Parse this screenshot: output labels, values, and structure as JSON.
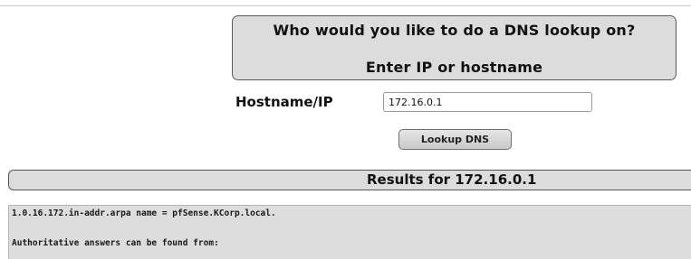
{
  "lookup_form": {
    "prompt_title": "Who would you like to do a DNS lookup on?",
    "prompt_subtitle": "Enter IP or hostname",
    "hostname_label": "Hostname/IP",
    "hostname_value": "172.16.0.1",
    "lookup_button_label": "Lookup DNS"
  },
  "results": {
    "title": "Results for 172.16.0.1",
    "lines": [
      "1.0.16.172.in-addr.arpa name = pfSense.KCorp.local.",
      "Authoritative answers can be found from:"
    ]
  },
  "colors": {
    "panel_background": "#dcdcdc",
    "border": "#5a5a5a",
    "page_background": "#ffffff"
  }
}
